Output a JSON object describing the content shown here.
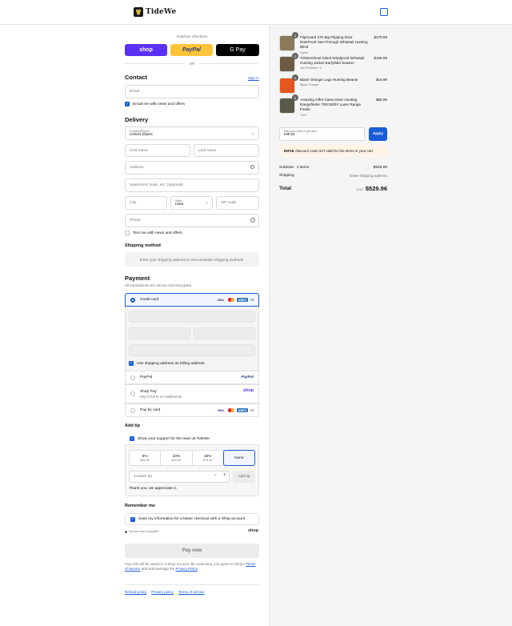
{
  "header": {
    "brand": "TideWe"
  },
  "express": {
    "title": "Express checkout",
    "shop_label": "shop",
    "paypal_label": "PayPal",
    "gpay_label": "G Pay",
    "or_label": "OR"
  },
  "contact": {
    "title": "Contact",
    "signin": "Sign in",
    "email_placeholder": "Email",
    "news_label": "Email me with news and offers"
  },
  "delivery": {
    "title": "Delivery",
    "country_label": "Country/Region",
    "country_value": "United States",
    "first_name": "First name",
    "last_name": "Last name",
    "address": "Address",
    "apartment": "Apartment, suite, etc. (optional)",
    "city": "City",
    "state_label": "State",
    "state_value": "Iowa",
    "zip": "ZIP code",
    "phone": "Phone",
    "text_me": "Text me with news and offers"
  },
  "shipping": {
    "title": "Shipping method",
    "info": "Enter your shipping address to view available shipping methods."
  },
  "payment": {
    "title": "Payment",
    "subtitle": "All transactions are secure and encrypted.",
    "credit_card": "Credit card",
    "more_cards": "+3",
    "billing_same": "Use shipping address as billing address",
    "paypal": "PayPal",
    "paypal_logo": "PayPal",
    "shoppay": "Shop Pay",
    "shoppay_sub": "Pay in full or in installments",
    "shoppay_logo": "shop",
    "paybycard": "Pay by card",
    "more_cards2": "+3",
    "visa": "VISA",
    "amex": "AMEX"
  },
  "tip": {
    "title": "Add tip",
    "support": "Show your support for the team at TideWe",
    "options": [
      {
        "pct": "5%",
        "amt": "$26.50"
      },
      {
        "pct": "10%",
        "amt": "$53.00"
      },
      {
        "pct": "15%",
        "amt": "$79.49"
      },
      {
        "pct": "None",
        "amt": ""
      }
    ],
    "custom_placeholder": "Custom tip",
    "minus": "−",
    "plus": "+",
    "add_button": "Add tip",
    "thanks": "Thank you, we appreciate it."
  },
  "remember": {
    "title": "Remember me",
    "save": "Save my information for a faster checkout with a Shop account",
    "secure": "Secure and encrypted",
    "shop_logo": "shop"
  },
  "pay_button": "Pay now",
  "legal": {
    "line1": "Your info will be saved to a Shop account. By continuing, you agree to Shop's",
    "tos": "Terms of Service",
    "and": "and acknowledge the",
    "privacy": "Privacy Policy",
    "end": "."
  },
  "footer": {
    "refund": "Refund policy",
    "privacy": "Privacy policy",
    "terms": "Terms of service"
  },
  "cart": {
    "items": [
      {
        "qty": "1",
        "name": "FlipGuard 270 Big Flipping Door RainProof See-Through Whitetail Hunting Blind",
        "variant": "Camo",
        "price": "$279.99",
        "color": "#8a7a5a"
      },
      {
        "qty": "1",
        "name": "TimberGhost Silent Windproof Whitetail Hunting Jacket Early/Mid Season",
        "variant": "Veil Whitetail / S",
        "price": "$159.99",
        "color": "#6b5a44"
      },
      {
        "qty": "1",
        "name": "Blaze Orange Logo Hunting Beanie",
        "variant": "Blaze Orange",
        "price": "$19.99",
        "color": "#e2571f"
      },
      {
        "qty": "1",
        "name": "Amazing Offer Camo Deer Hunting Rangefinder 700/1000Y Laser Range Finder",
        "variant": "700Y",
        "price": "$69.99",
        "color": "#5a5a4a"
      }
    ],
    "discount_label": "Discount code or gift card",
    "discount_value": "INF18",
    "apply": "Apply",
    "error_code": "INF18",
    "error_text": "discount code isn't valid for the items in your cart",
    "subtotal_label": "Subtotal · 4 items",
    "subtotal_value": "$529.96",
    "shipping_label": "Shipping",
    "shipping_value": "Enter shipping address",
    "total_label": "Total",
    "currency": "USD",
    "total_value": "$529.96"
  },
  "colors": {
    "accent": "#1a5bd8",
    "shop": "#5a31f4",
    "paypal": "#ffc439"
  }
}
